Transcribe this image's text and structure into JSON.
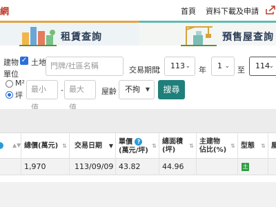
{
  "header": {
    "logo_fragment": "網",
    "nav_home": "首頁",
    "nav_download": "資料下載及申請"
  },
  "banner": {
    "rent_tab": "租賃查詢",
    "presale_tab": "預售屋查詢"
  },
  "filter": {
    "building_label": "建物",
    "land_label": "土地",
    "address_placeholder": "門牌/社區名稱",
    "period_label": "交易期間",
    "year_from": "113",
    "year_unit": "年",
    "month_from": "1",
    "to_label": "至",
    "year_to": "114",
    "unit_label": "單位",
    "unit_m2": "M²",
    "unit_ping": "坪",
    "min_placeholder": "最小值",
    "dash": "-",
    "max_placeholder": "最大值",
    "age_label": "屋齡",
    "age_value": "不拘",
    "search_button": "搜尋"
  },
  "table": {
    "headers": {
      "total_price": "總價(萬元)",
      "trade_date": "交易日期",
      "unit_price_line1": "單價",
      "unit_price_line2": "(萬元/坪)",
      "total_area_line1": "總面積",
      "total_area_line2": "(坪)",
      "main_ratio_line1": "主建物",
      "main_ratio_line2": "佔比(%)",
      "type": "型態",
      "last_fragment": "屋"
    },
    "rows": [
      {
        "total_price": "1,970",
        "trade_date": "113/09/09",
        "unit_price": "43.82",
        "total_area": "44.96",
        "main_ratio": "",
        "type_badge": "土"
      }
    ]
  },
  "colors": {
    "search_button": "#1f7f7a",
    "checkbox": "#2b6fdc",
    "type_badge": "#2e9e44",
    "help_icon": "#2b9ad8"
  }
}
